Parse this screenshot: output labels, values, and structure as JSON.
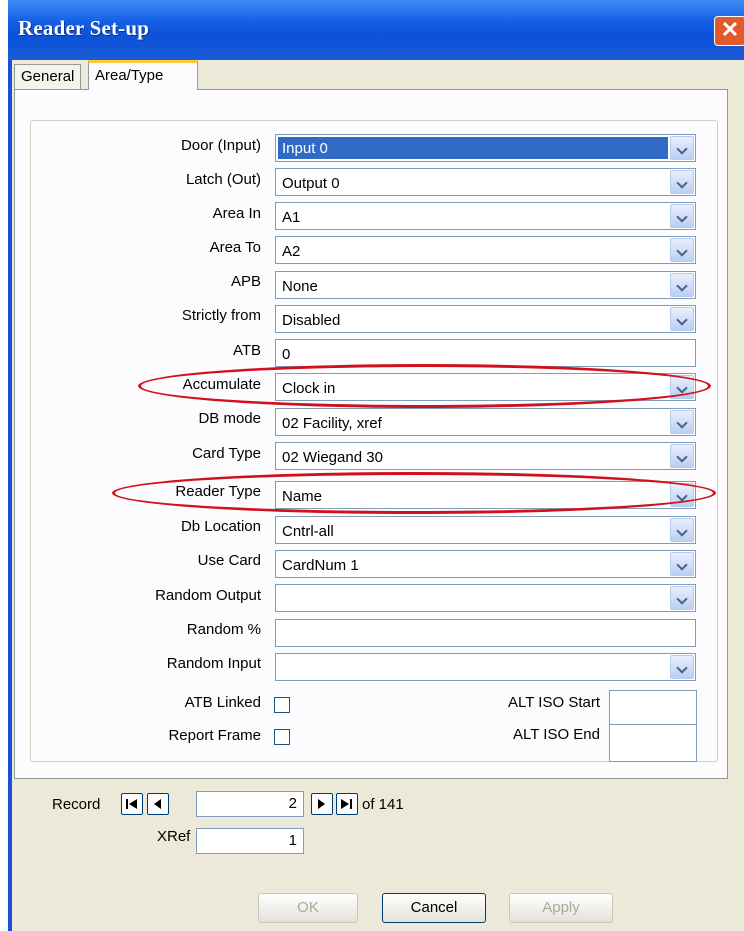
{
  "window": {
    "title": "Reader Set-up",
    "close": "✕"
  },
  "tabs": [
    {
      "label": "General",
      "active": false
    },
    {
      "label": "Area/Type",
      "active": true
    }
  ],
  "form": {
    "door_input": {
      "label": "Door (Input)",
      "value": "Input 0"
    },
    "latch_out": {
      "label": "Latch (Out)",
      "value": "Output 0"
    },
    "area_in": {
      "label": "Area In",
      "value": "A1"
    },
    "area_to": {
      "label": "Area To",
      "value": "A2"
    },
    "apb": {
      "label": "APB",
      "value": "None"
    },
    "strictly_from": {
      "label": "Strictly from",
      "value": "Disabled"
    },
    "atb": {
      "label": "ATB",
      "value": "0"
    },
    "accumulate": {
      "label": "Accumulate",
      "value": "Clock in"
    },
    "db_mode": {
      "label": "DB mode",
      "value": "02 Facility, xref"
    },
    "card_type": {
      "label": "Card Type",
      "value": "02 Wiegand 30"
    },
    "reader_type": {
      "label": "Reader Type",
      "value": "Name"
    },
    "db_location": {
      "label": "Db Location",
      "value": "Cntrl-all"
    },
    "use_card": {
      "label": "Use Card",
      "value": "CardNum 1"
    },
    "random_output": {
      "label": "Random Output",
      "value": ""
    },
    "random_pct": {
      "label": "Random %",
      "value": ""
    },
    "random_input": {
      "label": "Random Input",
      "value": ""
    },
    "atb_linked": {
      "label": "ATB Linked",
      "checked": false
    },
    "report_frame": {
      "label": "Report Frame",
      "checked": false
    },
    "alt_iso_start": {
      "label": "ALT ISO Start",
      "value": ""
    },
    "alt_iso_end": {
      "label": "ALT ISO End",
      "value": ""
    }
  },
  "record_nav": {
    "label": "Record",
    "current": "2",
    "of_text": "of 141",
    "xref_label": "XRef",
    "xref_value": "1"
  },
  "buttons": {
    "ok": "OK",
    "cancel": "Cancel",
    "apply": "Apply"
  },
  "annotations": {
    "highlight_color": "#d0101a",
    "highlighted_fields": [
      "Accumulate",
      "Reader Type"
    ]
  },
  "colors": {
    "title_bar": "#0b52d8",
    "selection": "#316ac5",
    "dialog_bg": "#ece9d8",
    "panel_bg": "#fcfcfe"
  }
}
